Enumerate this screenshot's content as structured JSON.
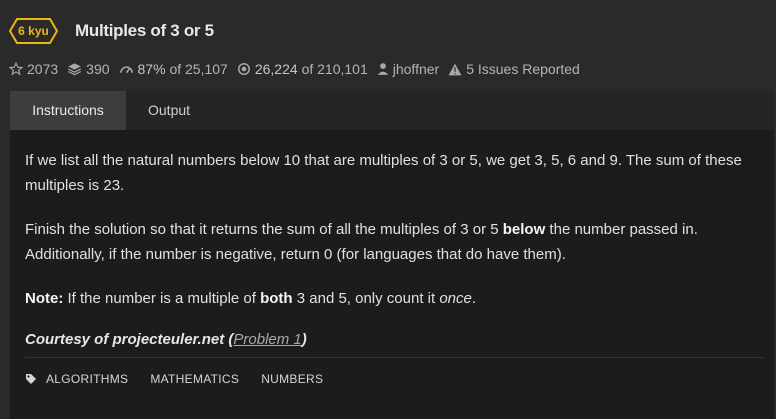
{
  "kata": {
    "rank": "6 kyu",
    "title": "Multiples of 3 or 5",
    "rank_color": "#ecb613"
  },
  "stats": {
    "stars": "2073",
    "collections": "390",
    "satisfaction": "87%",
    "satisfaction_of": "of",
    "satisfaction_total": "25,107",
    "completed": "26,224",
    "completed_of": "of",
    "completed_total": "210,101",
    "author": "jhoffner",
    "issues": "5 Issues Reported"
  },
  "tabs": [
    {
      "label": "Instructions",
      "active": true
    },
    {
      "label": "Output",
      "active": false
    }
  ],
  "description": {
    "p1": "If we list all the natural numbers below 10 that are multiples of 3 or 5, we get 3, 5, 6 and 9. The sum of these multiples is 23.",
    "p2_a": "Finish the solution so that it returns the sum of all the multiples of 3 or 5 ",
    "p2_bold": "below",
    "p2_b": " the number passed in. Additionally, if the number is negative, return 0 (for languages that do have them).",
    "note_label": "Note:",
    "note_a": " If the number is a multiple of ",
    "note_bold": "both",
    "note_b": " 3 and 5, only count it ",
    "note_em": "once",
    "note_end": ".",
    "courtesy": "Courtesy of projecteuler.net",
    "courtesy_open": " (",
    "courtesy_link": "Problem 1",
    "courtesy_close": ")"
  },
  "tags": [
    "ALGORITHMS",
    "MATHEMATICS",
    "NUMBERS"
  ],
  "icons": {
    "star": "star-icon",
    "collections": "stack-icon",
    "satisfaction": "gauge-icon",
    "completed": "target-icon",
    "author": "user-icon",
    "issues": "warning-icon",
    "tags": "tag-icon"
  }
}
